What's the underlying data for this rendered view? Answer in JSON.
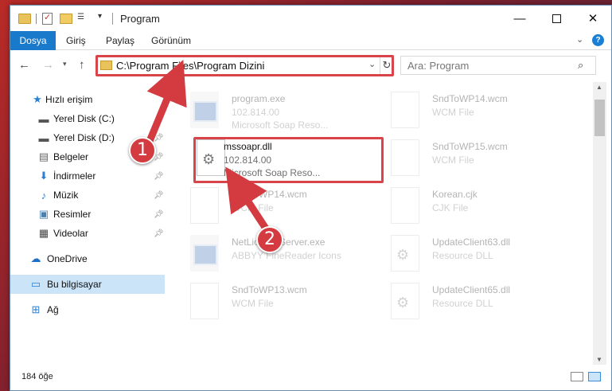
{
  "window": {
    "title": "Program",
    "min_glyph": "—",
    "close_glyph": "✕"
  },
  "ribbon": {
    "tabs": [
      "Dosya",
      "Giriş",
      "Paylaş",
      "Görünüm"
    ]
  },
  "address": {
    "path": "C:\\Program Files\\Program Dizini"
  },
  "search": {
    "placeholder": "Ara: Program"
  },
  "nav": {
    "items": [
      {
        "label": "Hızlı erişim",
        "icon": "star-icon",
        "pinned": false
      },
      {
        "label": "Yerel Disk (C:)",
        "icon": "drive-icon",
        "pinned": true
      },
      {
        "label": "Yerel Disk (D:)",
        "icon": "drive-icon",
        "pinned": true
      },
      {
        "label": "Belgeler",
        "icon": "documents-icon",
        "pinned": true
      },
      {
        "label": "İndirmeler",
        "icon": "downloads-icon",
        "pinned": true
      },
      {
        "label": "Müzik",
        "icon": "music-icon",
        "pinned": true
      },
      {
        "label": "Resimler",
        "icon": "pictures-icon",
        "pinned": true
      },
      {
        "label": "Videolar",
        "icon": "videos-icon",
        "pinned": true
      },
      {
        "label": "OneDrive",
        "icon": "cloud-icon",
        "pinned": false
      },
      {
        "label": "Bu bilgisayar",
        "icon": "computer-icon",
        "pinned": false
      },
      {
        "label": "Ağ",
        "icon": "network-icon",
        "pinned": false
      }
    ]
  },
  "files": [
    {
      "name": "program.exe",
      "line1": "102.814.00",
      "line2": "Microsoft Soap Reso...",
      "icon": "exe"
    },
    {
      "name": "SndToWP14.wcm",
      "line1": "WCM File",
      "line2": "",
      "icon": "doc"
    },
    {
      "name": "mssoapr.dll",
      "line1": "102.814.00",
      "line2": "Microsoft Soap Reso...",
      "icon": "gear"
    },
    {
      "name": "SndToWP15.wcm",
      "line1": "WCM File",
      "line2": "",
      "icon": "doc"
    },
    {
      "name": "SndToWP14.wcm",
      "line1": "WCM File",
      "line2": "",
      "icon": "doc"
    },
    {
      "name": "Korean.cjk",
      "line1": "CJK File",
      "line2": "",
      "icon": "doc"
    },
    {
      "name": "NetLicenseServer.exe",
      "line1": "ABBYY FineReader Icons",
      "line2": "",
      "icon": "exe"
    },
    {
      "name": "UpdateClient63.dll",
      "line1": "Resource DLL",
      "line2": "",
      "icon": "gear"
    },
    {
      "name": "SndToWP13.wcm",
      "line1": "WCM File",
      "line2": "",
      "icon": "doc"
    },
    {
      "name": "UpdateClient65.dll",
      "line1": "Resource DLL",
      "line2": "",
      "icon": "gear"
    }
  ],
  "status": {
    "count": "184 öğe"
  },
  "callouts": [
    "1",
    "2"
  ],
  "colors": {
    "accent": "#1979ca",
    "highlight": "#d9434a",
    "selected": "#cce4f7"
  }
}
